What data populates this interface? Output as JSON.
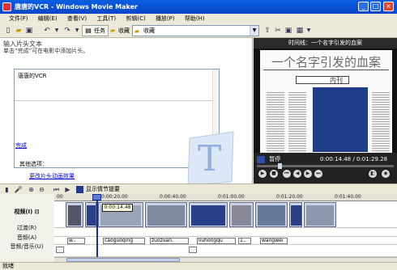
{
  "window": {
    "title": "唐唐的VCR - Windows Movie Maker",
    "minimize_glyph": "_",
    "maximize_glyph": "□",
    "close_glyph": "×"
  },
  "menu": [
    "文件(F)",
    "编辑(E)",
    "查看(V)",
    "工具(T)",
    "剪辑(C)",
    "播放(P)",
    "帮助(H)"
  ],
  "toolbar": {
    "tasks_label": "任务",
    "collections_label": "收藏",
    "collection_value": "收藏"
  },
  "title_pane": {
    "heading": "输入片头文本",
    "hint": "单击“完成”可在电影中添加片头。",
    "text_value": "唐唐的VCR",
    "done_label": "完成",
    "cancel_label": "取消",
    "more_options_label": "其他选项：",
    "animation_link": "更改片头动画效果"
  },
  "monitor": {
    "header": "时间线：一个名字引发的血案",
    "preview_headline": "一个名字引发的血案",
    "preview_inline_label": "内刊",
    "status": "暂停",
    "time": "0:00:14.48 / 0:01:29.28",
    "progress_fraction": 0.16
  },
  "timeline_toolbar": {
    "storyboard_label": "显示情节提要"
  },
  "timeline": {
    "ruler_labels": [
      "00",
      "0:00:20.00",
      "0:00:40.00",
      "0:01:00.00",
      "0:01:20.00",
      "0:01:40.00"
    ],
    "tracks": {
      "video": "视频(I)",
      "video_toggle": "⊟",
      "transition": "过渡(R)",
      "audio": "音频(A)",
      "audio_music": "音频/音乐(U)"
    },
    "playhead_time": "0:00:14.48",
    "audio_clips": [
      "w..",
      "caoguoqing",
      "zuozuan.",
      "liuhongqu",
      "1..",
      "wangwei"
    ]
  },
  "statusbar": {
    "text": "就绪"
  },
  "colors": {
    "titlebar": "#0846c8",
    "selection_blue": "#1f3d88",
    "link": "#0000cc"
  }
}
